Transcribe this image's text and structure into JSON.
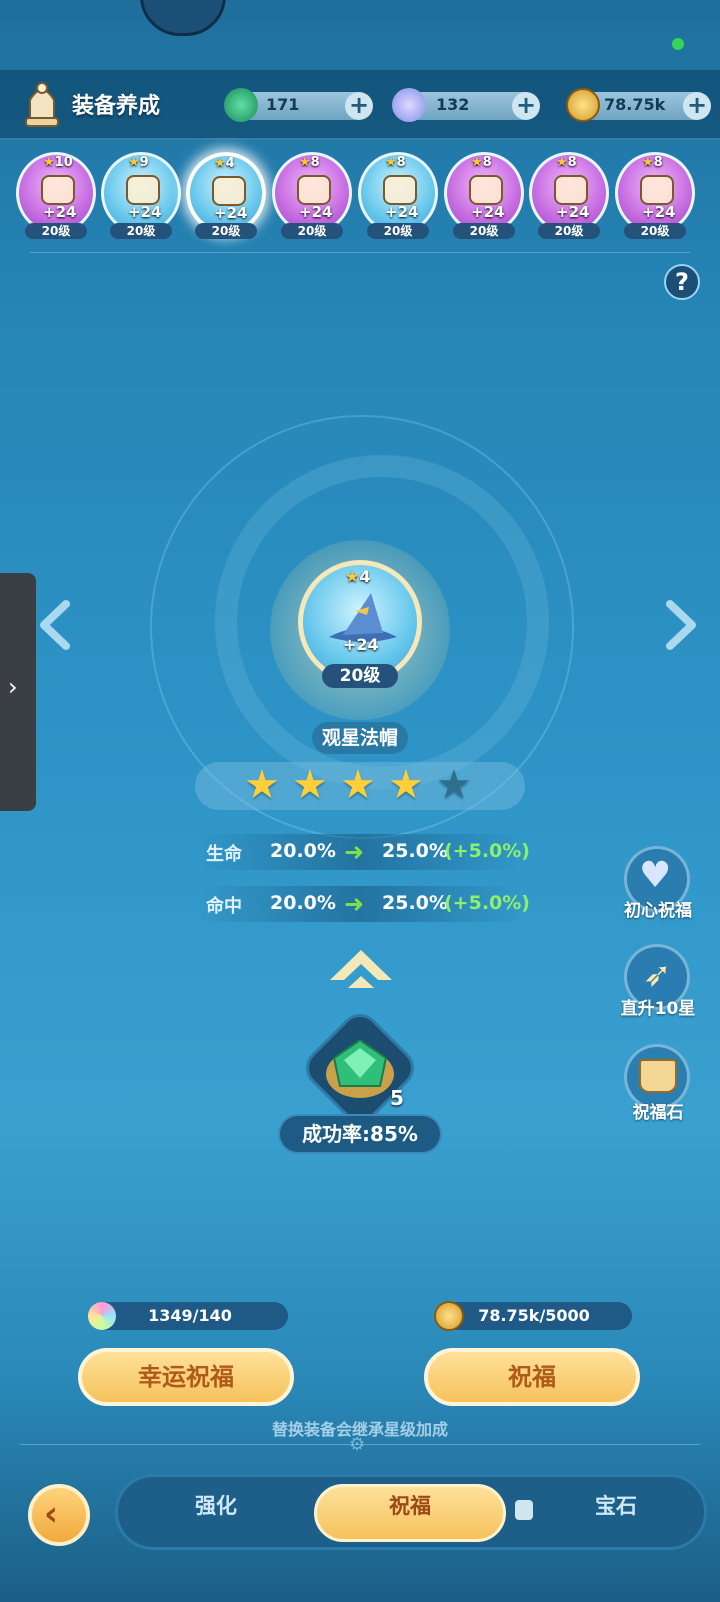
{
  "header": {
    "title": "装备养成",
    "resources": [
      {
        "icon": "green-gem-icon",
        "value": "171"
      },
      {
        "icon": "blue-crystal-icon",
        "value": "132"
      },
      {
        "icon": "gold-coin-icon",
        "value": "78.75k"
      }
    ]
  },
  "equipment": [
    {
      "name": "staff-icon",
      "stars": "10",
      "plus": "+24",
      "level": "20级",
      "color": "purple"
    },
    {
      "name": "orb-icon",
      "stars": "9",
      "plus": "+24",
      "level": "20级",
      "color": "blue"
    },
    {
      "name": "wizard-hat-icon",
      "stars": "4",
      "plus": "+24",
      "level": "20级",
      "color": "blue",
      "selected": true
    },
    {
      "name": "armor-icon",
      "stars": "8",
      "plus": "+24",
      "level": "20级",
      "color": "purple"
    },
    {
      "name": "bracer-icon",
      "stars": "8",
      "plus": "+24",
      "level": "20级",
      "color": "blue"
    },
    {
      "name": "boots-icon",
      "stars": "8",
      "plus": "+24",
      "level": "20级",
      "color": "purple"
    },
    {
      "name": "ring-icon",
      "stars": "8",
      "plus": "+24",
      "level": "20级",
      "color": "purple"
    },
    {
      "name": "necklace-icon",
      "stars": "8",
      "plus": "+24",
      "level": "20级",
      "color": "purple"
    }
  ],
  "help": "?",
  "main_item": {
    "stars": "4",
    "plus": "+24",
    "level": "20级",
    "name": "观星法帽",
    "star_rating": 4,
    "star_max": 5
  },
  "stats": [
    {
      "label": "生命",
      "from": "20.0%",
      "to": "25.0%",
      "bonus": "(+5.0%)"
    },
    {
      "label": "命中",
      "from": "20.0%",
      "to": "25.0%",
      "bonus": "(+5.0%)"
    }
  ],
  "material": {
    "count": "5",
    "success": "成功率:85%"
  },
  "side_actions": [
    {
      "label": "初心祝福",
      "icon": "heart-icon"
    },
    {
      "label": "直升10星",
      "icon": "rocket-icon"
    },
    {
      "label": "祝福石",
      "icon": "basket-icon"
    }
  ],
  "costs": {
    "lucky": "1349/140",
    "bless": "78.75k/5000"
  },
  "buttons": {
    "lucky_bless": "幸运祝福",
    "bless": "祝福"
  },
  "hint": "替换装备会继承星级加成",
  "tabs": {
    "strengthen": "强化",
    "bless": "祝福",
    "gem": "宝石"
  },
  "colors": {
    "accent": "#f5c25c",
    "bonus": "#8cf06a",
    "purple_item": "#c56be0",
    "blue_item": "#66c7ec"
  }
}
